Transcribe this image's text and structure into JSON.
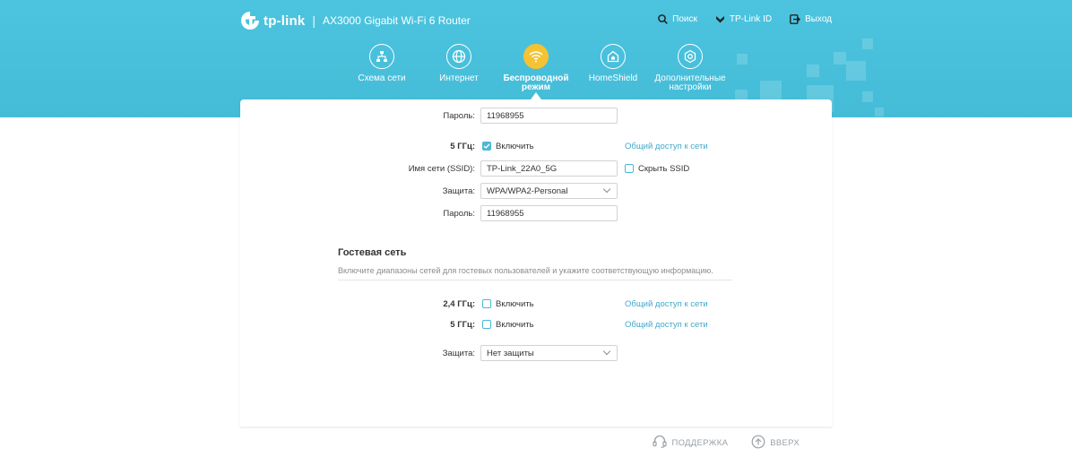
{
  "header": {
    "brand": "tp-link",
    "separator": "|",
    "model": "AX3000 Gigabit Wi-Fi 6 Router",
    "links": [
      {
        "label": "Поиск",
        "icon": "search-icon"
      },
      {
        "label": "TP-Link ID",
        "icon": "tplink-id-icon"
      },
      {
        "label": "Выход",
        "icon": "logout-icon"
      }
    ]
  },
  "nav": {
    "items": [
      {
        "label": "Схема сети",
        "icon": "network-map-icon"
      },
      {
        "label": "Интернет",
        "icon": "globe-icon"
      },
      {
        "label": "Беспроводной режим",
        "icon": "wifi-icon",
        "active": true
      },
      {
        "label": "HomeShield",
        "icon": "homeshield-icon"
      },
      {
        "label": "Дополнительные настройки",
        "icon": "gear-icon"
      }
    ]
  },
  "main": {
    "password_24_label": "Пароль:",
    "password_24_value": "11968955",
    "band5_label": "5 ГГц:",
    "band5_enable_label": "Включить",
    "band5_enabled": true,
    "band5_share_link": "Общий доступ к сети",
    "ssid_label": "Имя сети (SSID):",
    "ssid_value": "TP-Link_22A0_5G",
    "hide_ssid_label": "Скрыть SSID",
    "hide_ssid_checked": false,
    "security_label": "Защита:",
    "security_value": "WPA/WPA2-Personal",
    "password_5_label": "Пароль:",
    "password_5_value": "11968955"
  },
  "guest": {
    "title": "Гостевая сеть",
    "description": "Включите диапазоны сетей для гостевых пользователей и укажите соответствующую информацию.",
    "band24_label": "2,4 ГГц:",
    "band24_enable_label": "Включить",
    "band24_share_link": "Общий доступ к сети",
    "band5_label": "5 ГГц:",
    "band5_enable_label": "Включить",
    "band5_share_link": "Общий доступ к сети",
    "security_label": "Защита:",
    "security_value": "Нет защиты"
  },
  "footer": {
    "support_label": "ПОДДЕРЖКА",
    "top_label": "ВВЕРХ"
  },
  "colors": {
    "banner": "#4cc4df",
    "accent": "#4cb7d6",
    "active_nav": "#f5c332",
    "link": "#42a9cc"
  }
}
